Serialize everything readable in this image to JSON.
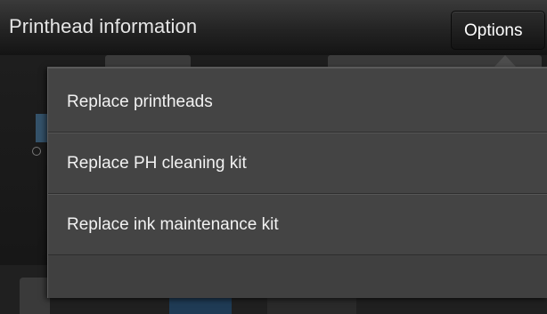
{
  "header": {
    "title": "Printhead information",
    "options_label": "Options"
  },
  "options_menu": {
    "items": [
      {
        "label": "Replace printheads"
      },
      {
        "label": "Replace PH cleaning kit"
      },
      {
        "label": "Replace ink maintenance kit"
      }
    ]
  },
  "colors": {
    "menu_background": "#444444",
    "titlebar": "#2a2a2a",
    "text": "#f2f2f2"
  }
}
